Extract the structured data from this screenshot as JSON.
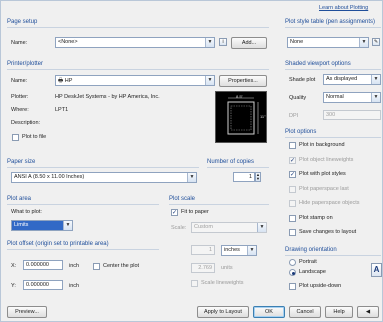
{
  "help_link": "Learn about Plotting",
  "page_setup": {
    "title": "Page setup",
    "name_label": "Name:",
    "name_value": "<None>",
    "add_button": "Add..."
  },
  "printer": {
    "title": "Printer/plotter",
    "name_label": "Name:",
    "name_value": "HP",
    "properties_button": "Properties...",
    "plotter_label": "Plotter:",
    "plotter_value": "HP DeskJet Systems - by HP America, Inc.",
    "where_label": "Where:",
    "where_value": "LPT1",
    "description_label": "Description:",
    "plot_to_file_label": "Plot to file",
    "preview_dim_w": "8.5\"",
    "preview_dim_h": "11\""
  },
  "paper_size": {
    "title": "Paper size",
    "value": "ANSI A (8.50 x 11.00 Inches)"
  },
  "copies": {
    "title": "Number of copies",
    "value": "1"
  },
  "plot_area": {
    "title": "Plot area",
    "what_label": "What to plot:",
    "what_value": "Limits"
  },
  "plot_scale": {
    "title": "Plot scale",
    "fit_label": "Fit to paper",
    "scale_label": "Scale:",
    "scale_value": "Custom",
    "value1": "1",
    "units": "inches",
    "value2": "2.769",
    "units2": "units",
    "lineweights": "Scale lineweights"
  },
  "plot_offset": {
    "title": "Plot offset (origin set to printable area)",
    "x_label": "X:",
    "x_value": "0.000000",
    "x_unit": "inch",
    "center_label": "Center the plot",
    "y_label": "Y:",
    "y_value": "0.000000",
    "y_unit": "inch"
  },
  "plot_style": {
    "title": "Plot style table (pen assignments)",
    "value": "None"
  },
  "shaded": {
    "title": "Shaded viewport options",
    "shade_label": "Shade plot",
    "shade_value": "As displayed",
    "quality_label": "Quality",
    "quality_value": "Normal",
    "dpi_label": "DPI",
    "dpi_value": "300"
  },
  "plot_options": {
    "title": "Plot options",
    "items": [
      {
        "label": "Plot in background",
        "checked": false,
        "disabled": false
      },
      {
        "label": "Plot object lineweights",
        "checked": true,
        "disabled": true
      },
      {
        "label": "Plot with plot styles",
        "checked": true,
        "disabled": false
      },
      {
        "label": "Plot paperspace last",
        "checked": false,
        "disabled": true
      },
      {
        "label": "Hide paperspace objects",
        "checked": false,
        "disabled": true
      },
      {
        "label": "Plot stamp on",
        "checked": false,
        "disabled": false
      },
      {
        "label": "Save changes to layout",
        "checked": false,
        "disabled": false
      }
    ]
  },
  "orientation": {
    "title": "Drawing orientation",
    "portrait": "Portrait",
    "landscape": "Landscape",
    "upside_down": "Plot upside-down",
    "icon": "A"
  },
  "footer": {
    "preview": "Preview...",
    "apply": "Apply to Layout",
    "ok": "OK",
    "cancel": "Cancel",
    "help": "Help"
  }
}
